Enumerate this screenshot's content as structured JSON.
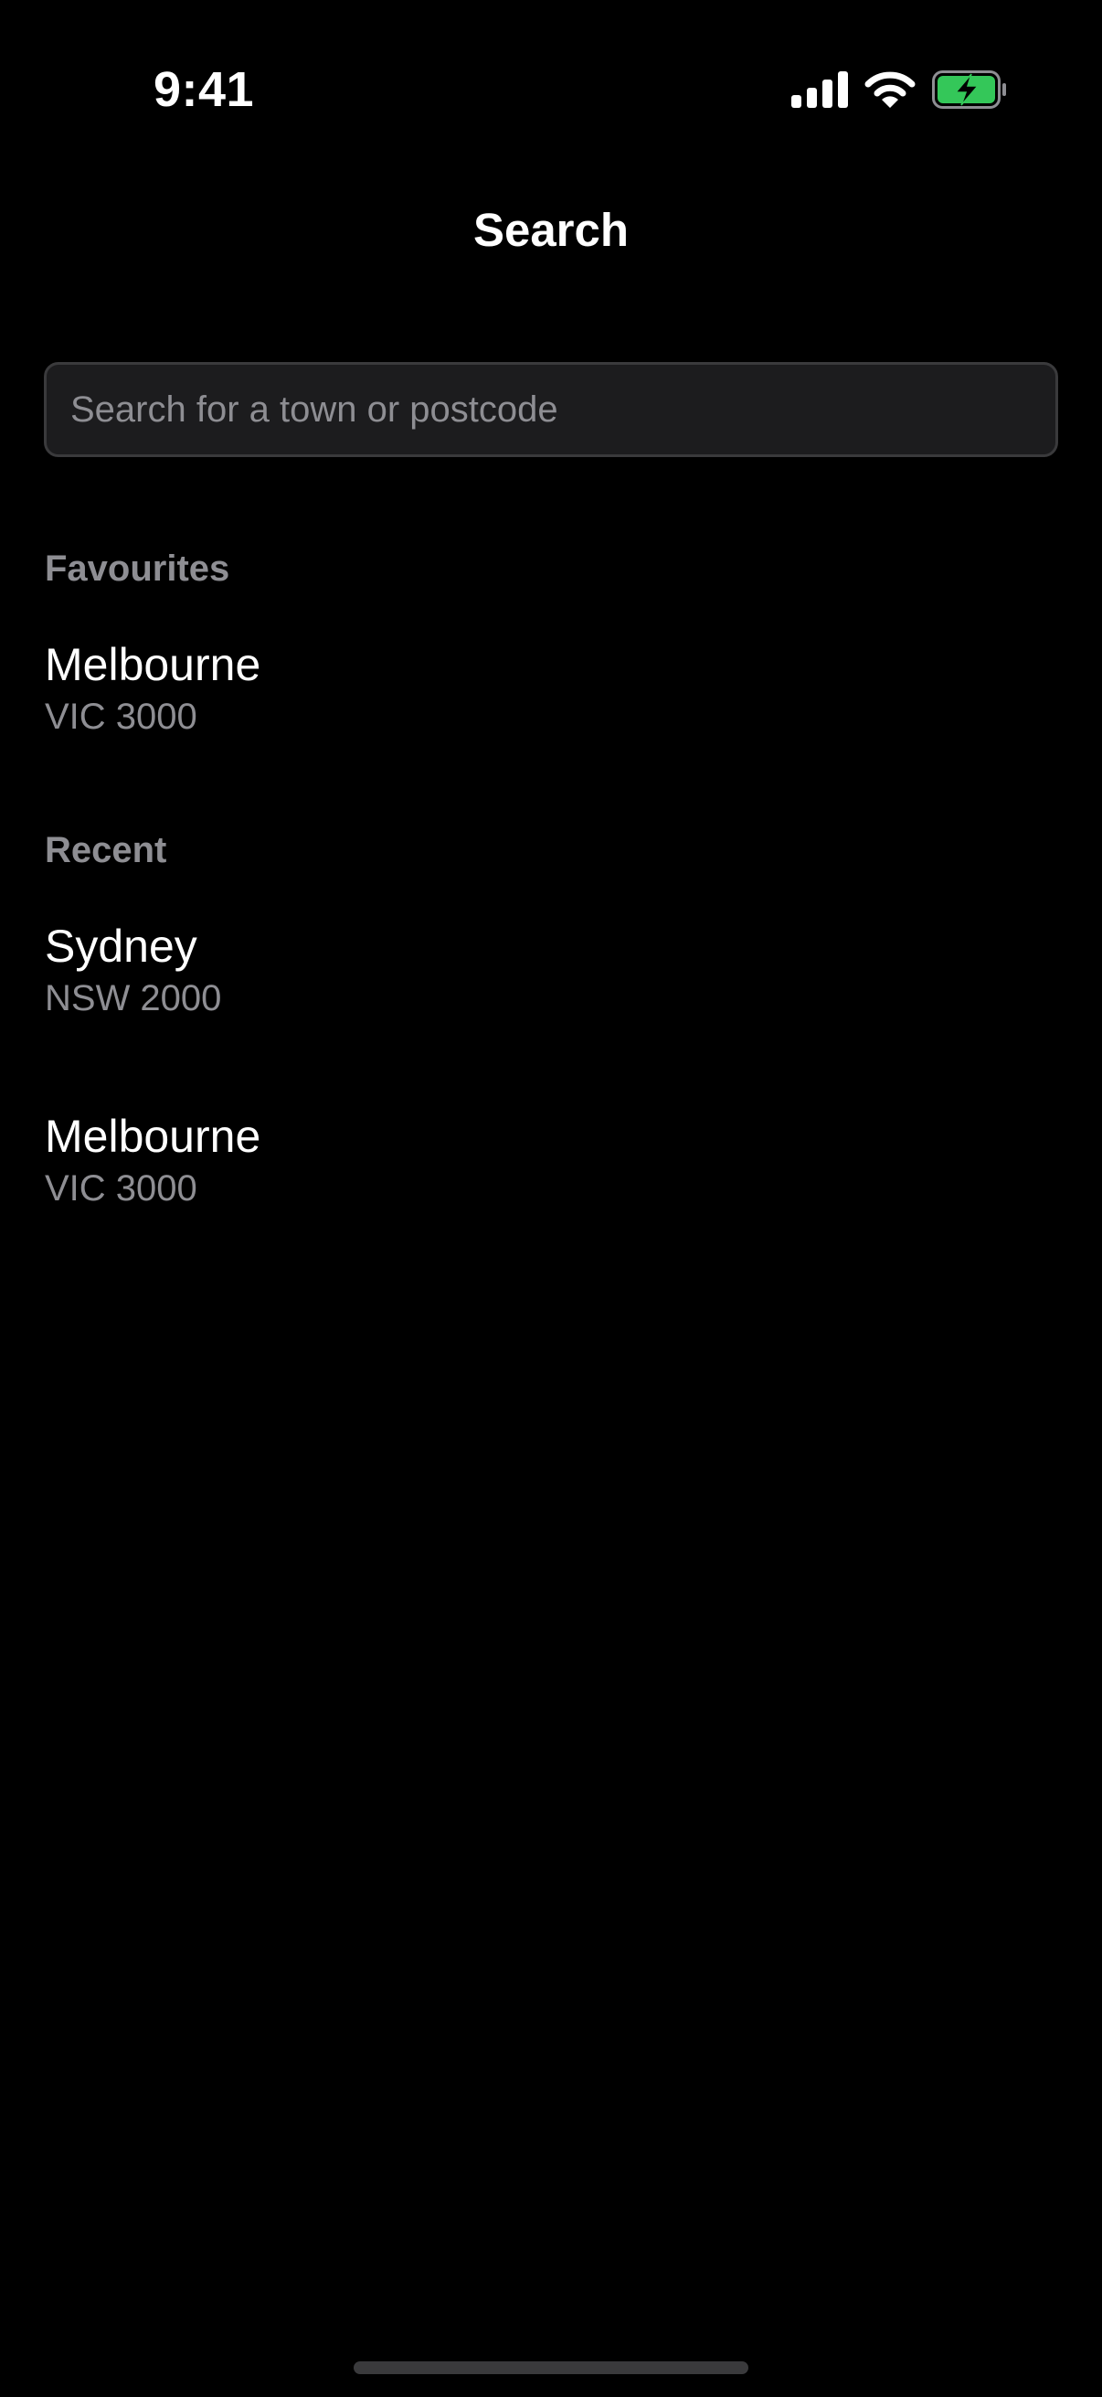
{
  "status_bar": {
    "time": "9:41",
    "signal_icon": "cellular-signal-icon",
    "wifi_icon": "wifi-icon",
    "battery_icon": "battery-charging-icon",
    "battery_color": "#34c759"
  },
  "nav": {
    "title": "Search"
  },
  "search": {
    "placeholder": "Search for a town or postcode",
    "value": ""
  },
  "favourites": {
    "header": "Favourites",
    "items": [
      {
        "name": "Melbourne",
        "detail": "VIC 3000"
      }
    ]
  },
  "recent": {
    "header": "Recent",
    "items": [
      {
        "name": "Sydney",
        "detail": "NSW 2000"
      },
      {
        "name": "Melbourne",
        "detail": "VIC 3000"
      }
    ]
  },
  "colors": {
    "background": "#000000",
    "text_primary": "#ffffff",
    "text_secondary": "#8e8e93",
    "field_background": "#1c1c1e",
    "field_border": "#3a3a3c"
  }
}
